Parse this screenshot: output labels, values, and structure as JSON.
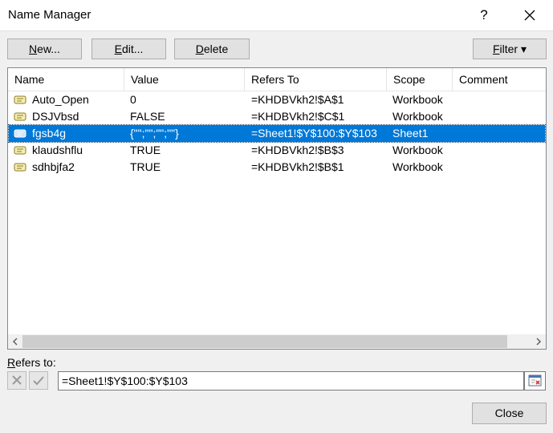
{
  "window": {
    "title": "Name Manager",
    "help": "?"
  },
  "toolbar": {
    "new_label_u": "N",
    "new_label_rest": "ew...",
    "edit_label_u": "E",
    "edit_label_rest": "dit...",
    "delete_label_u": "D",
    "delete_label_rest": "elete",
    "filter_label_u": "F",
    "filter_label_rest": "ilter",
    "filter_arrow": "▾"
  },
  "table": {
    "columns": [
      "Name",
      "Value",
      "Refers To",
      "Scope",
      "Comment"
    ],
    "rows": [
      {
        "name": "Auto_Open",
        "value": "0",
        "refers": "=KHDBVkh2!$A$1",
        "scope": "Workbook",
        "comment": ""
      },
      {
        "name": "DSJVbsd",
        "value": "FALSE",
        "refers": "=KHDBVkh2!$C$1",
        "scope": "Workbook",
        "comment": ""
      },
      {
        "name": "fgsb4g",
        "value": "{\"\";\"\";\"\";\"\"}",
        "refers": "=Sheet1!$Y$100:$Y$103",
        "scope": "Sheet1",
        "comment": ""
      },
      {
        "name": "klaudshflu",
        "value": "TRUE",
        "refers": "=KHDBVkh2!$B$3",
        "scope": "Workbook",
        "comment": ""
      },
      {
        "name": "sdhbjfa2",
        "value": "TRUE",
        "refers": "=KHDBVkh2!$B$1",
        "scope": "Workbook",
        "comment": ""
      }
    ],
    "selected_index": 2
  },
  "refers_to": {
    "label_u": "R",
    "label_rest": "efers to:",
    "value": "=Sheet1!$Y$100:$Y$103"
  },
  "footer": {
    "close_label": "Close"
  },
  "colors": {
    "selection": "#0078d7",
    "icon_fill": "#f5efb0",
    "icon_stroke": "#8a7a2a"
  }
}
